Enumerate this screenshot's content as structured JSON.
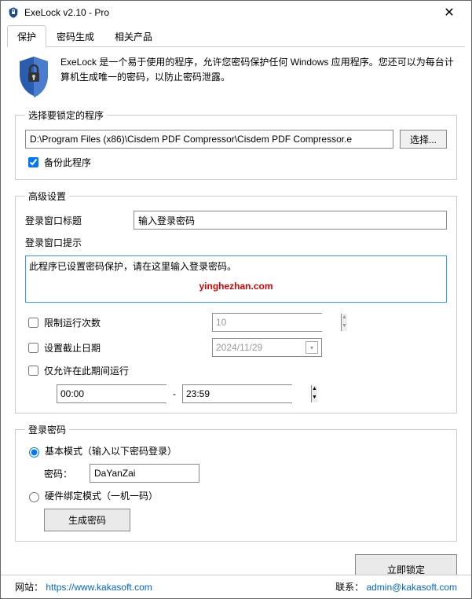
{
  "window": {
    "title": "ExeLock v2.10 - Pro"
  },
  "tabs": {
    "protect": "保护",
    "pwdgen": "密码生成",
    "related": "相关产品"
  },
  "intro": "ExeLock 是一个易于使用的程序，允许您密码保护任何 Windows 应用程序。您还可以为每台计算机生成唯一的密码，以防止密码泄露。",
  "program": {
    "legend": "选择要锁定的程序",
    "path": "D:\\Program Files (x86)\\Cisdem PDF Compressor\\Cisdem PDF Compressor.e",
    "select": "选择...",
    "backup": "备份此程序"
  },
  "advanced": {
    "legend": "高级设置",
    "titleLabel": "登录窗口标题",
    "titleValue": "输入登录密码",
    "promptLabel": "登录窗口提示",
    "promptValue": "此程序已设置密码保护，请在这里输入登录密码。",
    "watermark": "yinghezhan.com",
    "limitRuns": "限制运行次数",
    "limitRunsVal": "10",
    "setExpiry": "设置截止日期",
    "expiryVal": "2024/11/29",
    "allowPeriod": "仅允许在此期间运行",
    "timeFrom": "00:00",
    "timeTo": "23:59"
  },
  "password": {
    "legend": "登录密码",
    "basic": "基本模式（输入以下密码登录）",
    "pwdLabel": "密码：",
    "pwdValue": "DaYanZai",
    "hardware": "硬件绑定模式（一机一码）",
    "genBtn": "生成密码"
  },
  "lockBtn": "立即锁定",
  "footer": {
    "siteLabel": "网站：",
    "siteUrl": "https://www.kakasoft.com",
    "contactLabel": "联系：",
    "contactEmail": "admin@kakasoft.com"
  }
}
